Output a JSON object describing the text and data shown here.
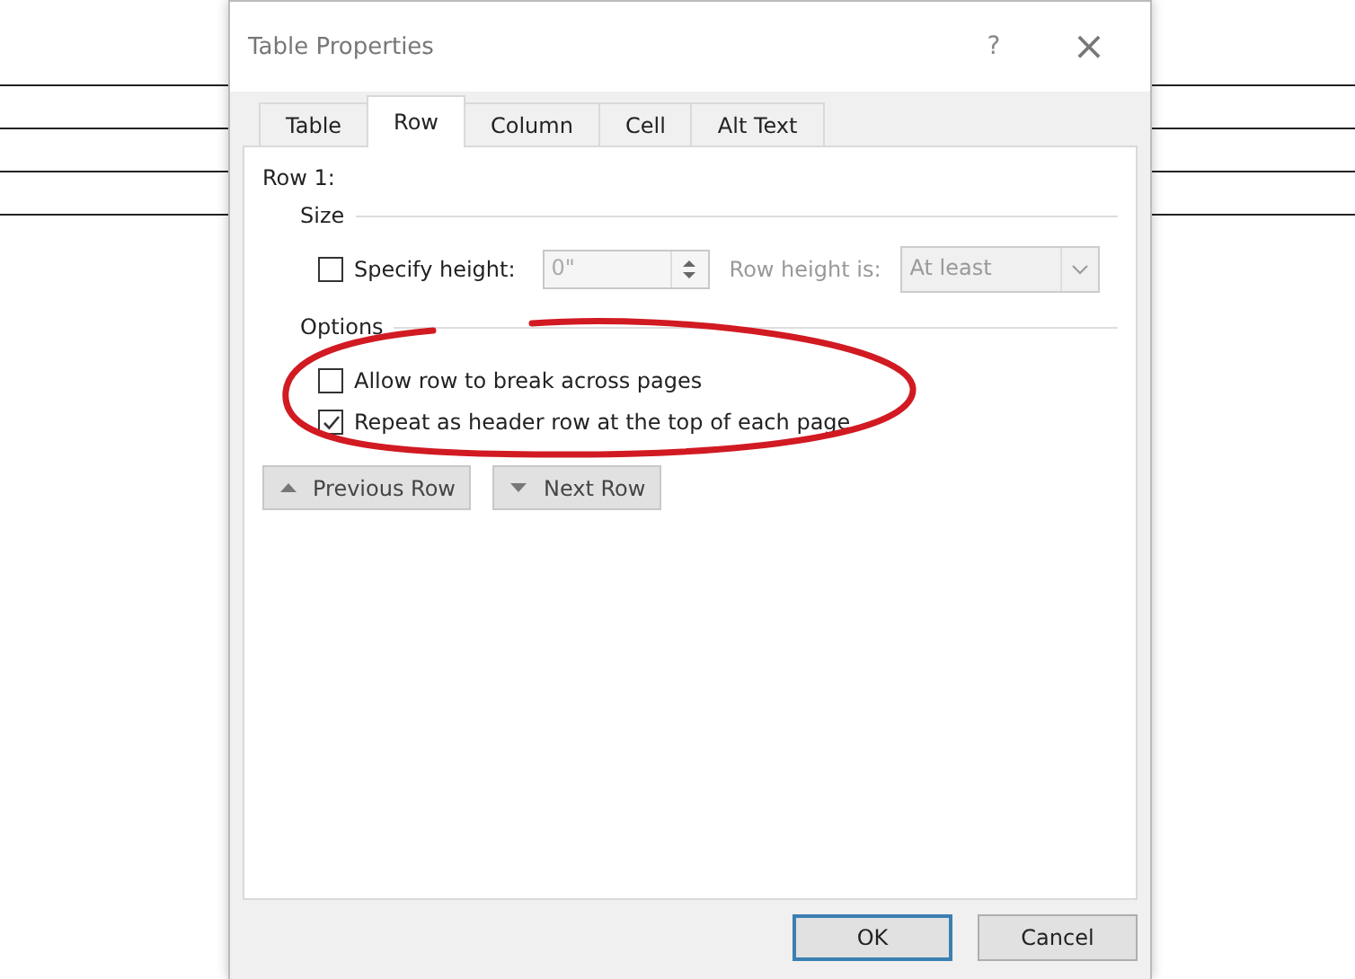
{
  "window": {
    "title": "Table Properties",
    "help": "?",
    "close": "×"
  },
  "tabs": [
    {
      "label": "Table",
      "selected": false
    },
    {
      "label": "Row",
      "selected": true
    },
    {
      "label": "Column",
      "selected": false
    },
    {
      "label": "Cell",
      "selected": false
    },
    {
      "label": "Alt Text",
      "selected": false
    }
  ],
  "row_heading": "Row 1:",
  "size": {
    "heading": "Size",
    "specify_height": {
      "label": "Specify height:",
      "checked": false
    },
    "height_value": "0\"",
    "row_height_is": {
      "label": "Row height is:",
      "value": "At least",
      "disabled": true
    }
  },
  "options": {
    "heading": "Options",
    "items": [
      {
        "label": "Allow row to break across pages",
        "checked": false
      },
      {
        "label": "Repeat as header row at the top of each page",
        "checked": true
      }
    ]
  },
  "nav_buttons": [
    {
      "label": "Previous Row",
      "kind": "up"
    },
    {
      "label": "Next Row",
      "kind": "down"
    }
  ],
  "annotation": {
    "kind": "ellipse"
  },
  "buttons": [
    {
      "label": "OK",
      "default": true
    },
    {
      "label": "Cancel",
      "default": false
    }
  ]
}
